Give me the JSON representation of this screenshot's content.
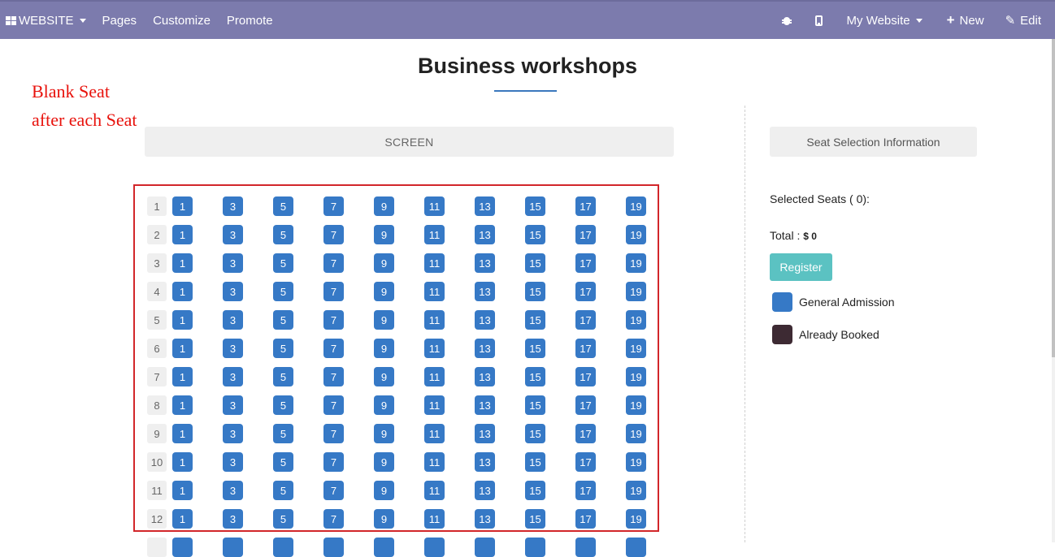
{
  "navbar": {
    "website_label": "WEBSITE",
    "pages_label": "Pages",
    "customize_label": "Customize",
    "promote_label": "Promote",
    "my_website_label": "My Website",
    "new_label": "New",
    "edit_label": "Edit"
  },
  "page": {
    "title": "Business workshops"
  },
  "annotation": {
    "line1": "Blank Seat",
    "line2": "after each Seat"
  },
  "screen_label": "SCREEN",
  "seating": {
    "row_labels": [
      "1",
      "2",
      "3",
      "4",
      "5",
      "6",
      "7",
      "8",
      "9",
      "10",
      "11",
      "12"
    ],
    "seat_numbers": [
      "1",
      "3",
      "5",
      "7",
      "9",
      "11",
      "13",
      "15",
      "17",
      "19"
    ],
    "seat_color": "#3679c6"
  },
  "panel": {
    "header": "Seat Selection Information",
    "selected_seats_label": "Selected Seats ( 0):",
    "total_label": "Total :",
    "total_value": "$ 0",
    "register_label": "Register",
    "legend": [
      {
        "label": "General Admission",
        "color": "#3679c6"
      },
      {
        "label": "Already Booked",
        "color": "#3d2a33"
      }
    ]
  }
}
